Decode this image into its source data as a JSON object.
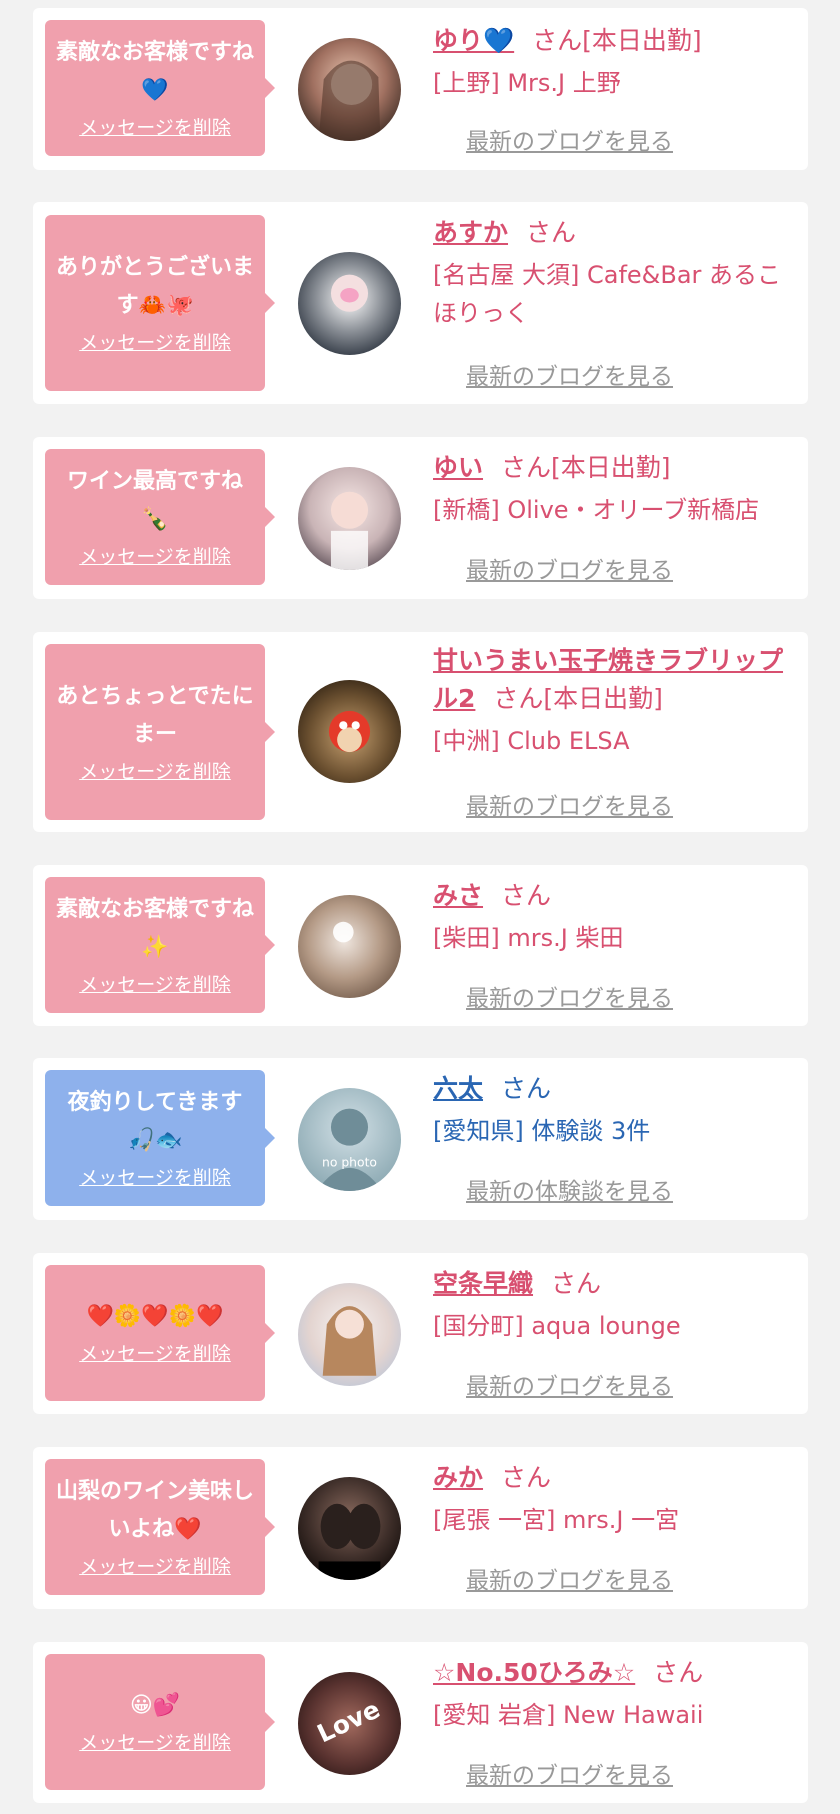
{
  "delete_label": "メッセージを削除",
  "cards": [
    {
      "message": "素敵なお客様ですね💙",
      "name": "ゆり💙",
      "suffix": "さん[本日出勤]",
      "shop": "[上野] Mrs.J 上野",
      "link": "最新のブログを見る"
    },
    {
      "message": "ありがとうございます🦀🐙",
      "name": "あすか",
      "suffix": "さん",
      "shop": "[名古屋 大須] Cafe&Bar あるこほりっく",
      "link": "最新のブログを見る"
    },
    {
      "message": "ワイン最高ですね🍾",
      "name": "ゆい",
      "suffix": "さん[本日出勤]",
      "shop": "[新橋] Olive・オリーブ新橋店",
      "link": "最新のブログを見る"
    },
    {
      "message": "あとちょっとでたにまー",
      "name": "甘いうまい玉子焼きラブリップル2",
      "suffix": "さん[本日出勤]",
      "shop": "[中洲] Club ELSA",
      "link": "最新のブログを見る"
    },
    {
      "message": "素敵なお客様ですね✨",
      "name": "みさ",
      "suffix": "さん",
      "shop": "[柴田] mrs.J 柴田",
      "link": "最新のブログを見る"
    },
    {
      "message": "夜釣りしてきます🎣🐟",
      "name": "六太",
      "suffix": "さん",
      "shop": "[愛知県] 体験談 3件",
      "link": "最新の体験談を見る",
      "avatar_text": "no photo"
    },
    {
      "message": "❤️🌼❤️🌼❤️",
      "name": "空条早織",
      "suffix": "さん",
      "shop": "[国分町] aqua lounge",
      "link": "最新のブログを見る"
    },
    {
      "message": "山梨のワイン美味しいよね❤️",
      "name": "みか",
      "suffix": "さん",
      "shop": "[尾張 一宮] mrs.J 一宮",
      "link": "最新のブログを見る"
    },
    {
      "message": "😀💕",
      "name": "☆No.50ひろみ☆",
      "suffix": "さん",
      "shop": "[愛知 岩倉] New Hawaii",
      "link": "最新のブログを見る",
      "avatar_text": "Love"
    }
  ],
  "colors": {
    "pink_bubble": "#f0a0ad",
    "blue_bubble": "#8eb1ec",
    "name_pink": "#d85070",
    "name_blue": "#2a66b3",
    "link_gray": "#999999"
  }
}
